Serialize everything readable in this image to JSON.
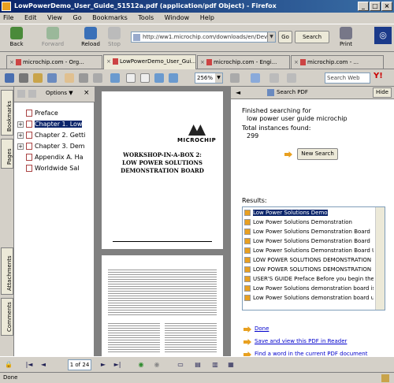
{
  "window": {
    "title": "LowPowerDemo_User_Guide_51512a.pdf (application/pdf Object) - Firefox"
  },
  "menu": [
    "File",
    "Edit",
    "View",
    "Go",
    "Bookmarks",
    "Tools",
    "Window",
    "Help"
  ],
  "nav": {
    "back_label": "Back",
    "forward_label": "Forward",
    "reload_label": "Reload",
    "stop_label": "Stop",
    "url": "http://ww1.microchip.com/downloads/en/Dev",
    "go_label": "Go",
    "search_label": "Search",
    "print_label": "Print"
  },
  "tabs": [
    {
      "label": "microchip.com - Org..."
    },
    {
      "label": "LowPowerDemo_User_Gui..."
    },
    {
      "label": "microchip.com - Engi..."
    },
    {
      "label": "microchip.com - ..."
    }
  ],
  "pdf_toolbar": {
    "zoom": "256%",
    "search_web_placeholder": "Search Web"
  },
  "left_tabs": {
    "bookmarks": "Bookmarks",
    "pages": "Pages",
    "attachments": "Attachments",
    "comments": "Comments"
  },
  "bookmarks": {
    "options_label": "Options",
    "items": [
      {
        "label": "Preface"
      },
      {
        "label": "Chapter 1. Low"
      },
      {
        "label": "Chapter 2. Getti"
      },
      {
        "label": "Chapter 3. Dem"
      },
      {
        "label": "Appendix A. Ha"
      },
      {
        "label": "Worldwide Sal"
      }
    ]
  },
  "document": {
    "logo_text": "MICROCHIP",
    "title_line1": "WORKSHOP-IN-A-BOX 2:",
    "title_line2": "LOW POWER SOLUTIONS",
    "title_line3": "DEMONSTRATION BOARD"
  },
  "search_panel": {
    "title": "Search PDF",
    "hide_label": "Hide",
    "searching_for_label": "Finished searching for",
    "query": "low power user guide microchip",
    "total_label": "Total instances found:",
    "total": "299",
    "new_search_label": "New Search",
    "results_label": "Results:",
    "results": [
      {
        "text": "Low Power Solutions Demo"
      },
      {
        "text": "Low Power Solutions Demonstration"
      },
      {
        "text": "Low Power Solutions Demonstration Board"
      },
      {
        "text": "Low Power Solutions Demonstration Board"
      },
      {
        "text": "Low Power Solutions Demonstration Board U"
      },
      {
        "text": "LOW POWER SOLUTIONS DEMONSTRATION"
      },
      {
        "text": "LOW POWER SOLUTIONS DEMONSTRATION"
      },
      {
        "text": "USER'S GUIDE Preface Before you begin the"
      },
      {
        "text": "Low Power Solutions demonstration board is"
      },
      {
        "text": "Low Power Solutions demonstration board use"
      }
    ],
    "done_link": "Done",
    "save_link": "Save and view this PDF in Reader",
    "find_link": "Find a word in the current PDF document"
  },
  "bottom_nav": {
    "page_indicator": "1 of 24"
  },
  "status": {
    "text": "Done"
  },
  "colors": {
    "title_bar": "#0a246a",
    "selection": "#0a246a",
    "link": "#0000cc",
    "chrome": "#d4d0c8"
  }
}
